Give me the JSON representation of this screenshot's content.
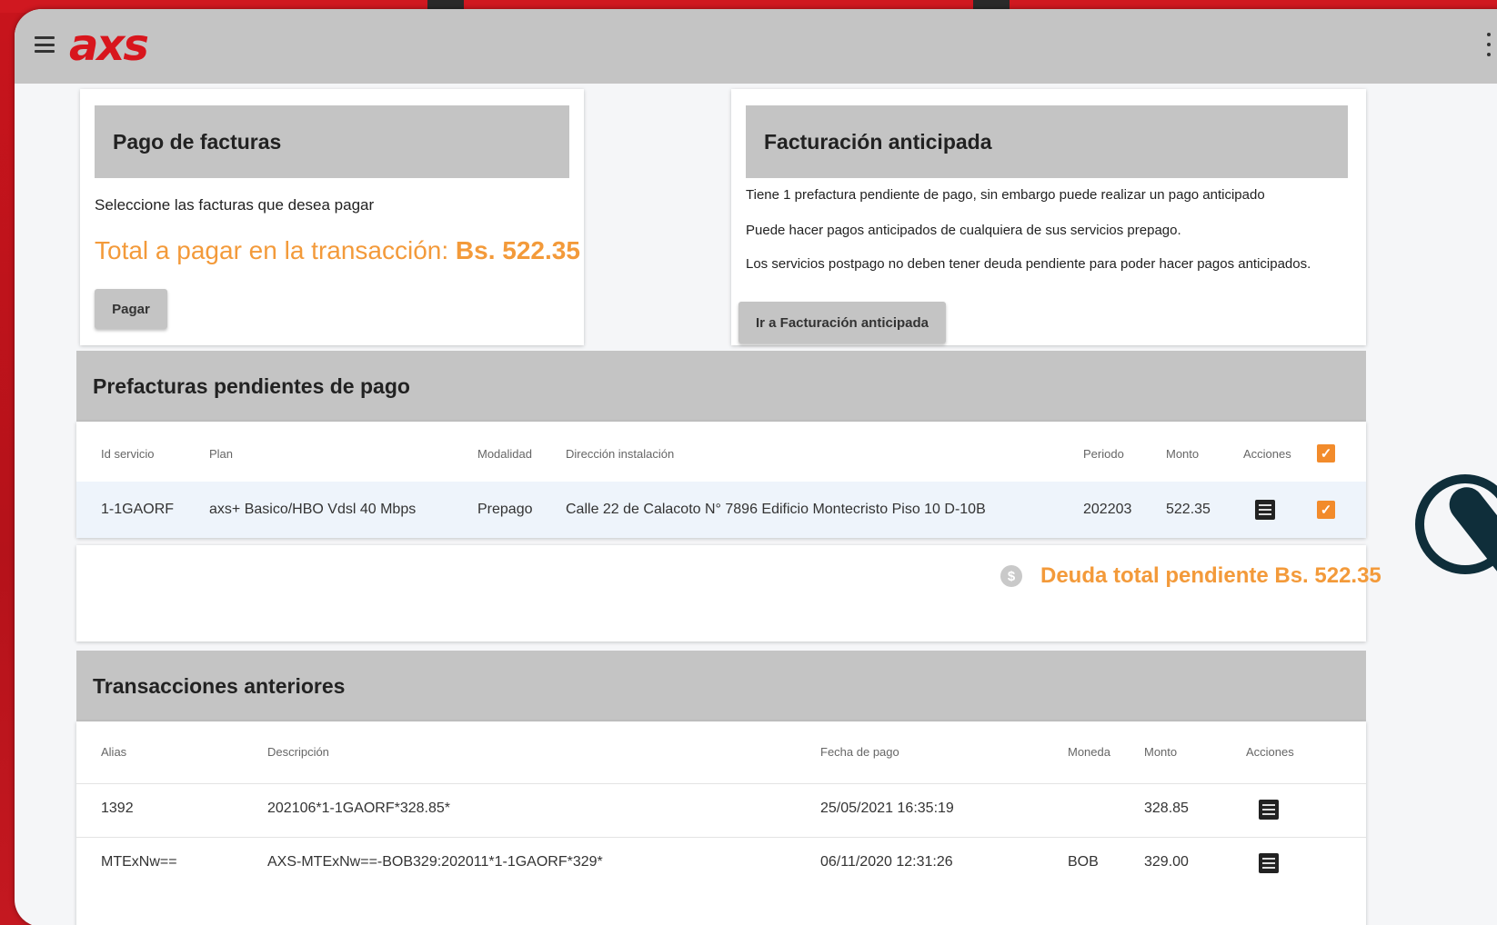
{
  "app": {
    "logo_text": "axs",
    "brand_color": "#d8161d",
    "accent_color": "#f39a3a"
  },
  "pago_facturas": {
    "title": "Pago de facturas",
    "instructions": "Seleccione las facturas que desea pagar",
    "total_label": "Total a pagar en la transacción:",
    "total_value": "Bs. 522.35",
    "pay_button": "Pagar"
  },
  "facturacion_anticipada": {
    "title": "Facturación anticipada",
    "line1": "Tiene 1 prefactura pendiente de pago, sin embargo puede realizar un pago anticipado",
    "line2": "Puede hacer pagos anticipados de cualquiera de sus servicios prepago.",
    "line3": "Los servicios postpago no deben tener deuda pendiente para poder hacer pagos anticipados.",
    "button": "Ir a Facturación anticipada"
  },
  "prefacturas": {
    "title": "Prefacturas pendientes de pago",
    "columns": [
      "Id servicio",
      "Plan",
      "Modalidad",
      "Dirección instalación",
      "Periodo",
      "Monto",
      "Acciones"
    ],
    "rows": [
      {
        "id": "1-1GAORF",
        "plan": "axs+ Basico/HBO Vdsl 40 Mbps",
        "modalidad": "Prepago",
        "direccion": "Calle 22 de Calacoto N° 7896 Edificio Montecristo Piso 10 D-10B",
        "periodo": "202203",
        "monto": "522.35"
      }
    ],
    "total_label": "Deuda total pendiente Bs. 522.35",
    "checkmark": "✓"
  },
  "transacciones": {
    "title": "Transacciones anteriores",
    "columns": [
      "Alias",
      "Descripción",
      "Fecha de pago",
      "Moneda",
      "Monto",
      "Acciones"
    ],
    "rows": [
      {
        "alias": "1392",
        "descripcion": "202106*1-1GAORF*328.85*",
        "fecha": "25/05/2021 16:35:19",
        "moneda": "",
        "monto": "328.85"
      },
      {
        "alias": "MTExNw==",
        "descripcion": "AXS-MTExNw==-BOB329:202011*1-1GAORF*329*",
        "fecha": "06/11/2020 12:31:26",
        "moneda": "BOB",
        "monto": "329.00"
      }
    ]
  }
}
